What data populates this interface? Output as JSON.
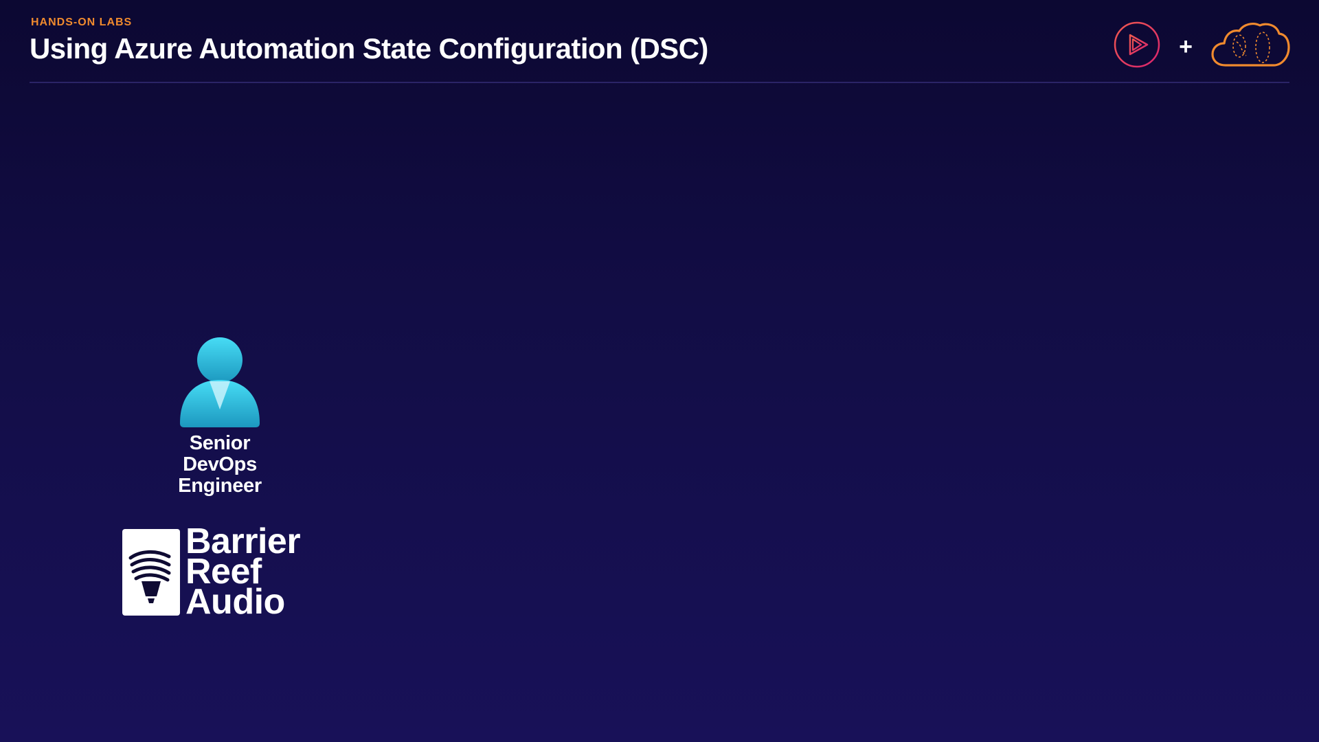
{
  "header": {
    "eyebrow": "HANDS-ON LABS",
    "title": "Using Azure Automation State Configuration (DSC)"
  },
  "logos": {
    "plus": "+",
    "left_icon": "play-circle-icon",
    "right_icon": "cloud-icon"
  },
  "persona": {
    "icon": "person-icon",
    "role": "Senior DevOps Engineer"
  },
  "company": {
    "icon": "reef-lamp-icon",
    "line1": "Barrier",
    "line2": "Reef",
    "line3": "Audio"
  },
  "colors": {
    "accent_orange": "#f08a2e",
    "brand_pink": "#e8336d",
    "persona_cyan": "#32c6e4",
    "background": "#120d45"
  }
}
